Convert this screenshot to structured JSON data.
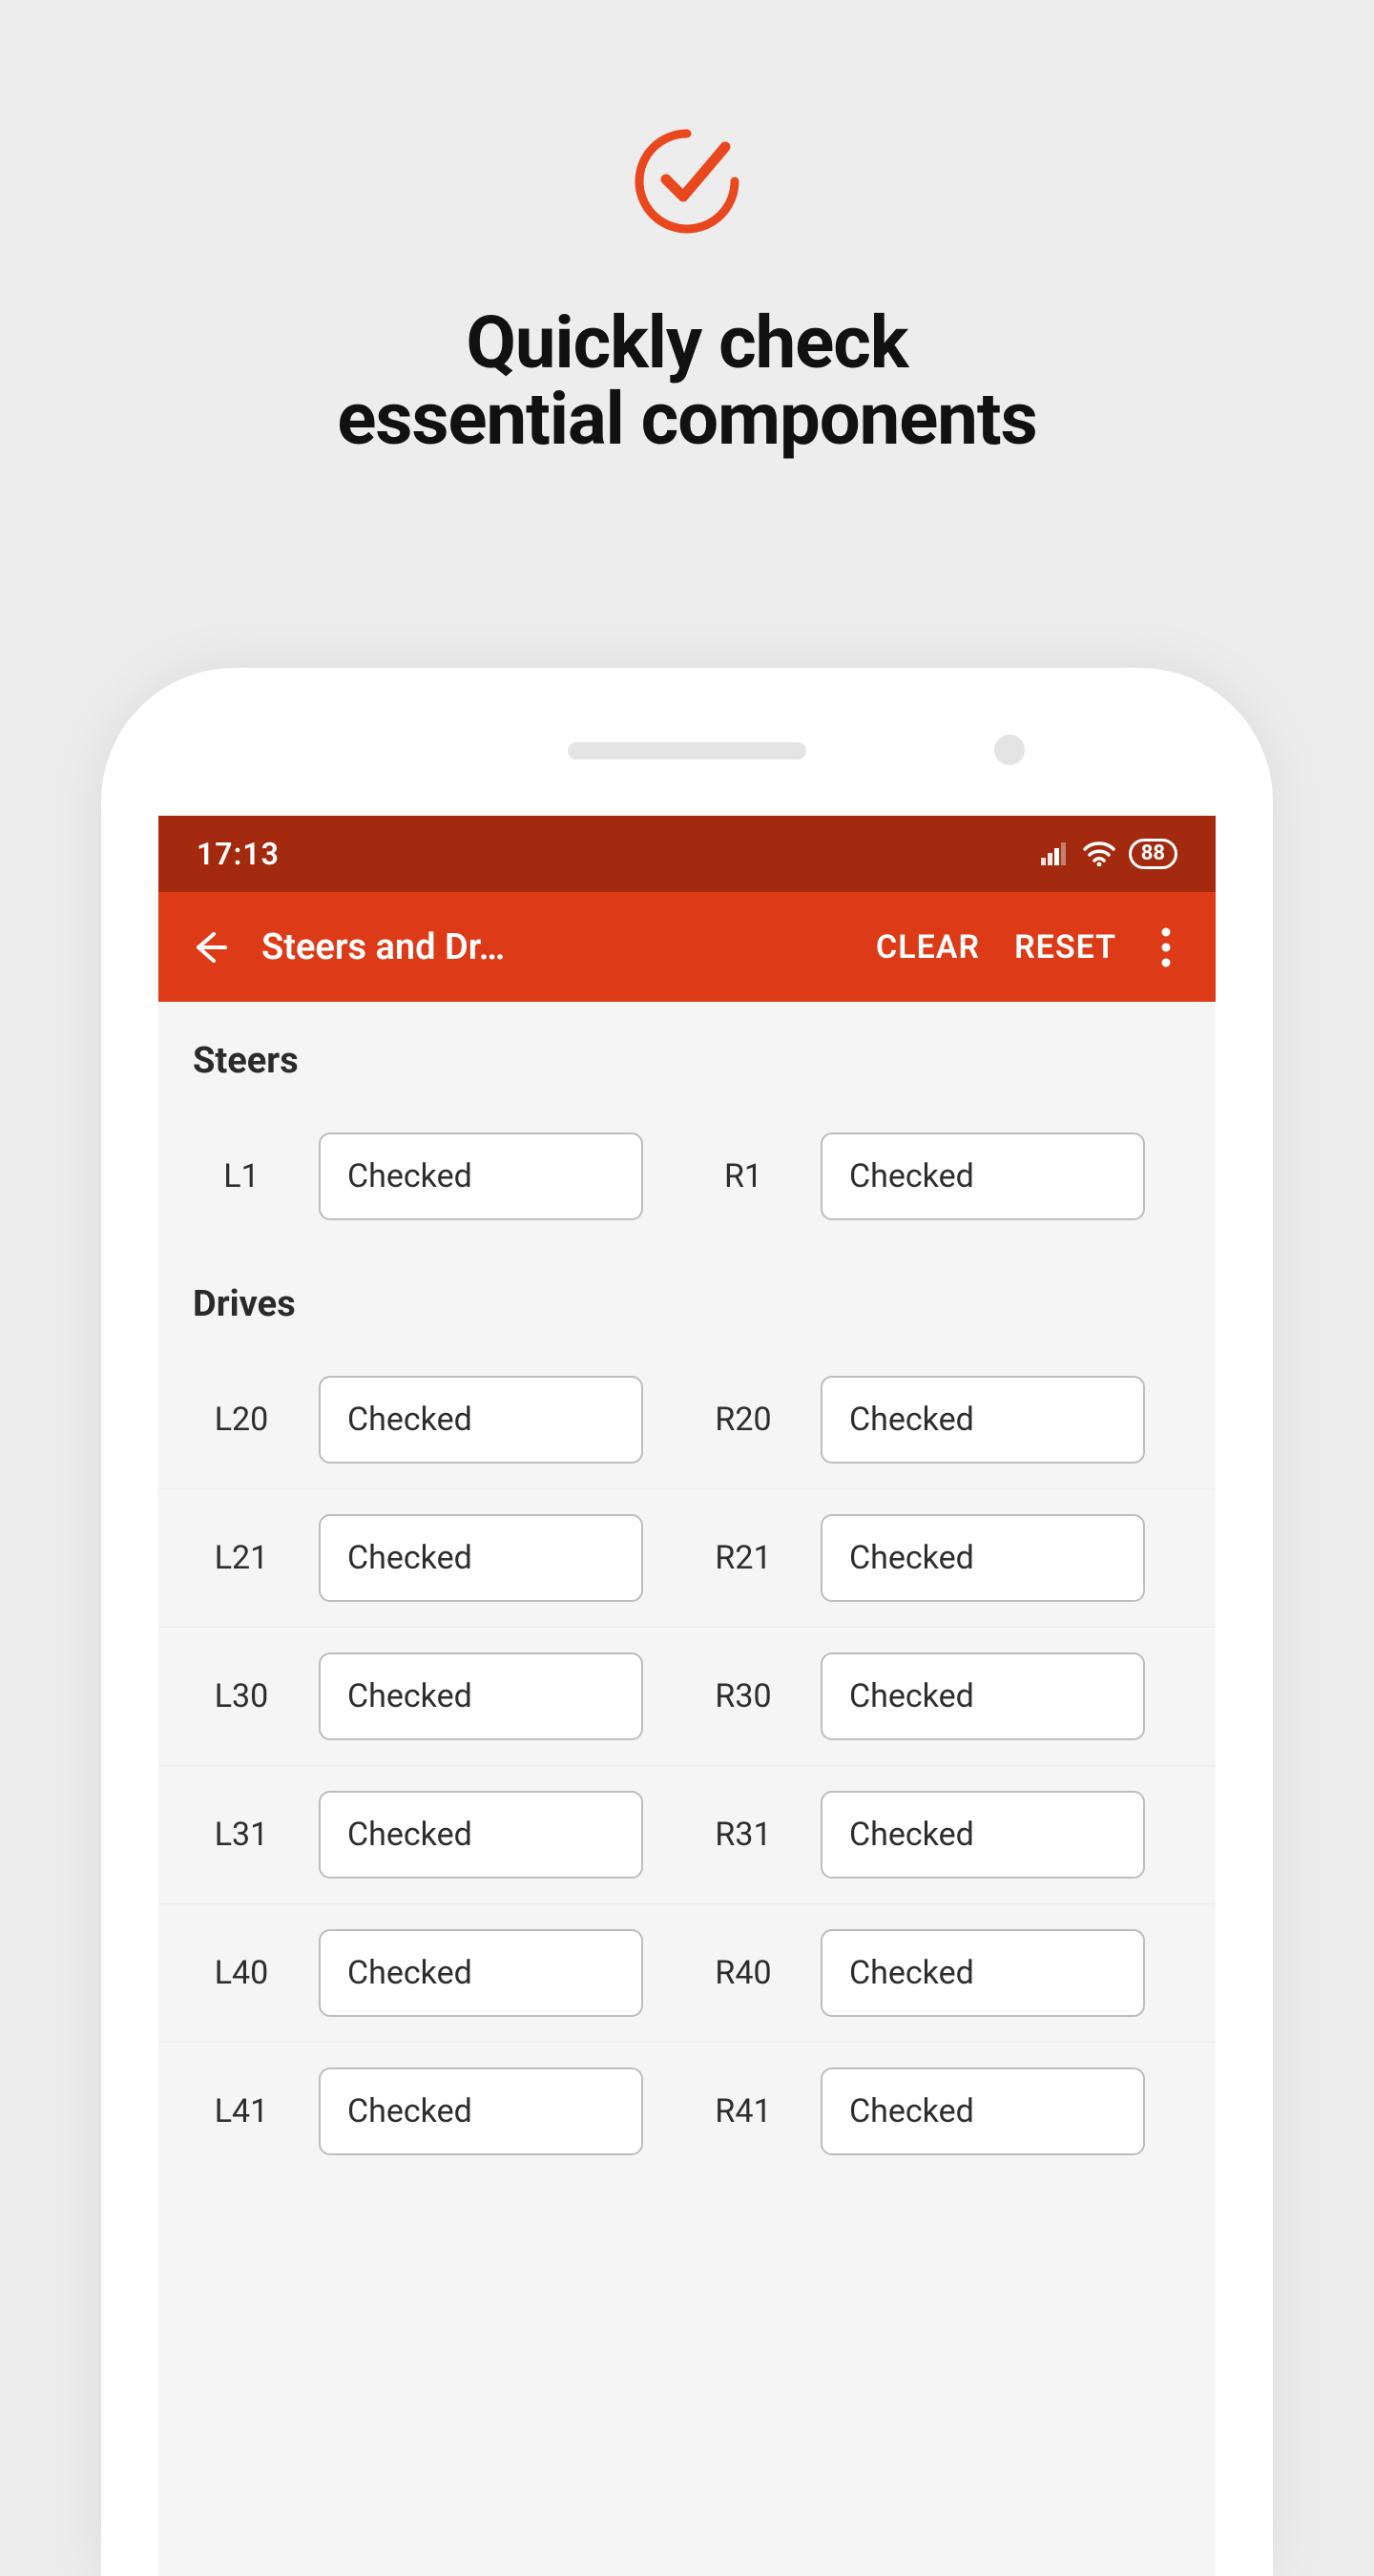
{
  "hero": {
    "title_line1": "Quickly check",
    "title_line2": "essential components"
  },
  "status": {
    "time": "17:13",
    "battery": "88"
  },
  "appbar": {
    "title": "Steers and Dr…",
    "clear": "CLEAR",
    "reset": "RESET"
  },
  "sections": {
    "steers": {
      "title": "Steers",
      "rows": [
        {
          "left_label": "L1",
          "left_status": "Checked",
          "right_label": "R1",
          "right_status": "Checked"
        }
      ]
    },
    "drives": {
      "title": "Drives",
      "rows": [
        {
          "left_label": "L20",
          "left_status": "Checked",
          "right_label": "R20",
          "right_status": "Checked"
        },
        {
          "left_label": "L21",
          "left_status": "Checked",
          "right_label": "R21",
          "right_status": "Checked"
        },
        {
          "left_label": "L30",
          "left_status": "Checked",
          "right_label": "R30",
          "right_status": "Checked"
        },
        {
          "left_label": "L31",
          "left_status": "Checked",
          "right_label": "R31",
          "right_status": "Checked"
        },
        {
          "left_label": "L40",
          "left_status": "Checked",
          "right_label": "R40",
          "right_status": "Checked"
        },
        {
          "left_label": "L41",
          "left_status": "Checked",
          "right_label": "R41",
          "right_status": "Checked"
        }
      ]
    }
  }
}
